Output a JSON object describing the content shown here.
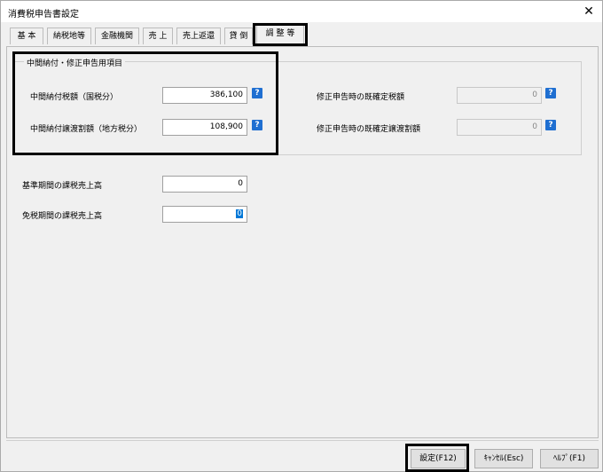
{
  "window": {
    "title": "消費税申告書設定",
    "close": "✕"
  },
  "tabs": [
    "基 本",
    "納税地等",
    "金融機関",
    "売 上",
    "売上返還",
    "貸 倒",
    "調 整 等"
  ],
  "group": {
    "title": "中間納付・修正申告用項目",
    "rows": [
      {
        "label": "中間納付税額（国税分）",
        "value": "386,100",
        "right_label": "修正申告時の既確定税額",
        "right_value": "0"
      },
      {
        "label": "中間納付譲渡割額（地方税分）",
        "value": "108,900",
        "right_label": "修正申告時の既確定譲渡割額",
        "right_value": "0"
      }
    ]
  },
  "fields": [
    {
      "label": "基準期間の課税売上高",
      "value": "0"
    },
    {
      "label": "免税期間の課税売上高",
      "value": "0"
    }
  ],
  "help": "?",
  "buttons": {
    "ok": "設定(F12)",
    "cancel": "ｷｬﾝｾﾙ(Esc)",
    "help": "ﾍﾙﾌﾟ(F1)"
  }
}
